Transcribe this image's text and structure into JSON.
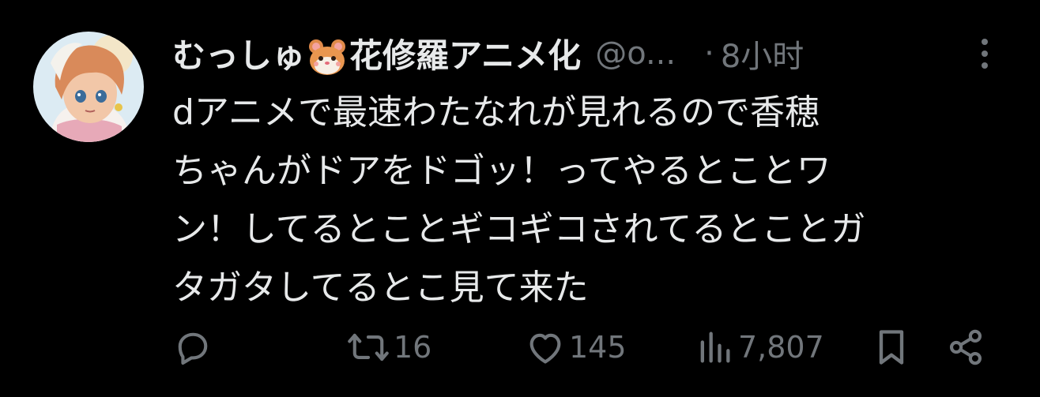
{
  "tweet": {
    "author": {
      "display_name_prefix": "むっしゅ",
      "emoji_icon": "hamster-face-icon",
      "display_name_suffix": "花修羅アニメ化",
      "handle": "@o...",
      "avatar_icon": "anime-avatar-icon"
    },
    "separator": "·",
    "time": "8小时",
    "text": "dアニメで最速わたなれが見れるので香穂\nちゃんがドアをドゴッ！ってやるとことワ\nン！してるとことギコギコされてるとことガ\nタガタしてるとこ見て来た",
    "more_icon": "more-vertical-icon"
  },
  "actions": {
    "reply": {
      "icon": "reply-icon",
      "count": ""
    },
    "retweet": {
      "icon": "retweet-icon",
      "count": "16"
    },
    "like": {
      "icon": "heart-icon",
      "count": "145"
    },
    "views": {
      "icon": "views-icon",
      "count": "7,807"
    },
    "bookmark": {
      "icon": "bookmark-icon"
    },
    "share": {
      "icon": "share-icon"
    }
  },
  "colors": {
    "background": "#000000",
    "text_primary": "#e7e9ea",
    "text_secondary": "#71767b"
  }
}
